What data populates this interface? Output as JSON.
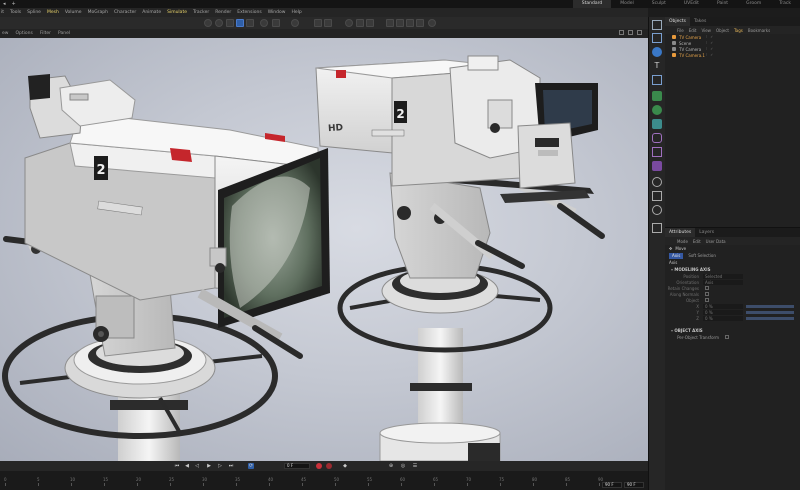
{
  "topbar": {
    "layouts": [
      "Standard",
      "Model",
      "Sculpt",
      "UVEdit",
      "Paint",
      "Groom",
      "Track"
    ],
    "active_layout": "Standard"
  },
  "menubar": {
    "items": [
      "it",
      "Tools",
      "Spline",
      "Mesh",
      "Volume",
      "MoGraph",
      "Character",
      "Animate",
      "Simulate",
      "Tracker",
      "Render",
      "Extensions",
      "Window",
      "Help"
    ],
    "highlighted": [
      "Mesh",
      "Simulate"
    ]
  },
  "viewport_menu": {
    "items": [
      "ew",
      "Options",
      "Filter",
      "Panel"
    ]
  },
  "scene": {
    "camera_number_left": "2",
    "camera_number_right": "2",
    "hd_label": "HD"
  },
  "timeline": {
    "frame_field": "0 F",
    "ticks": [
      "0",
      "5",
      "10",
      "15",
      "20",
      "25",
      "30",
      "35",
      "40",
      "45",
      "50",
      "55",
      "60",
      "65",
      "70",
      "75",
      "80",
      "85",
      "90"
    ],
    "end_fields": [
      "90 F",
      "90 F"
    ]
  },
  "objects_panel": {
    "tabs": [
      "Objects",
      "Takes"
    ],
    "menu": [
      "File",
      "Edit",
      "View",
      "Object",
      "Tags",
      "Bookmarks"
    ],
    "rows": [
      {
        "name": "TV Camera",
        "color": "#e89a3c",
        "selected": true
      },
      {
        "name": "Scene",
        "color": "#8a8a8a",
        "selected": false
      },
      {
        "name": "TV Camera",
        "color": "#8a8a8a",
        "selected": false
      },
      {
        "name": "TV Camera.1",
        "color": "#e89a3c",
        "selected": true
      }
    ]
  },
  "attributes_panel": {
    "tabs": [
      "Attributes",
      "Layers"
    ],
    "menu": [
      "Mode",
      "Edit",
      "User Data"
    ],
    "tool_name": "Move",
    "modes": [
      "Axis",
      "Soft Selection"
    ],
    "active_mode": "Axis",
    "sub_heading": "Axis",
    "section1": "MODELING AXIS",
    "props": [
      {
        "label": "Position",
        "value": "Selected"
      },
      {
        "label": "Orientation",
        "value": "Axis"
      },
      {
        "label": "Retain Changes",
        "value": ""
      },
      {
        "label": "Along Normals",
        "value": ""
      },
      {
        "label": "Object",
        "value": ""
      },
      {
        "label": "X",
        "value": "0 %"
      },
      {
        "label": "Y",
        "value": "0 %"
      },
      {
        "label": "Z",
        "value": "0 %"
      }
    ],
    "section2": "OBJECT AXIS",
    "per_object": "Per-Object Transform"
  }
}
